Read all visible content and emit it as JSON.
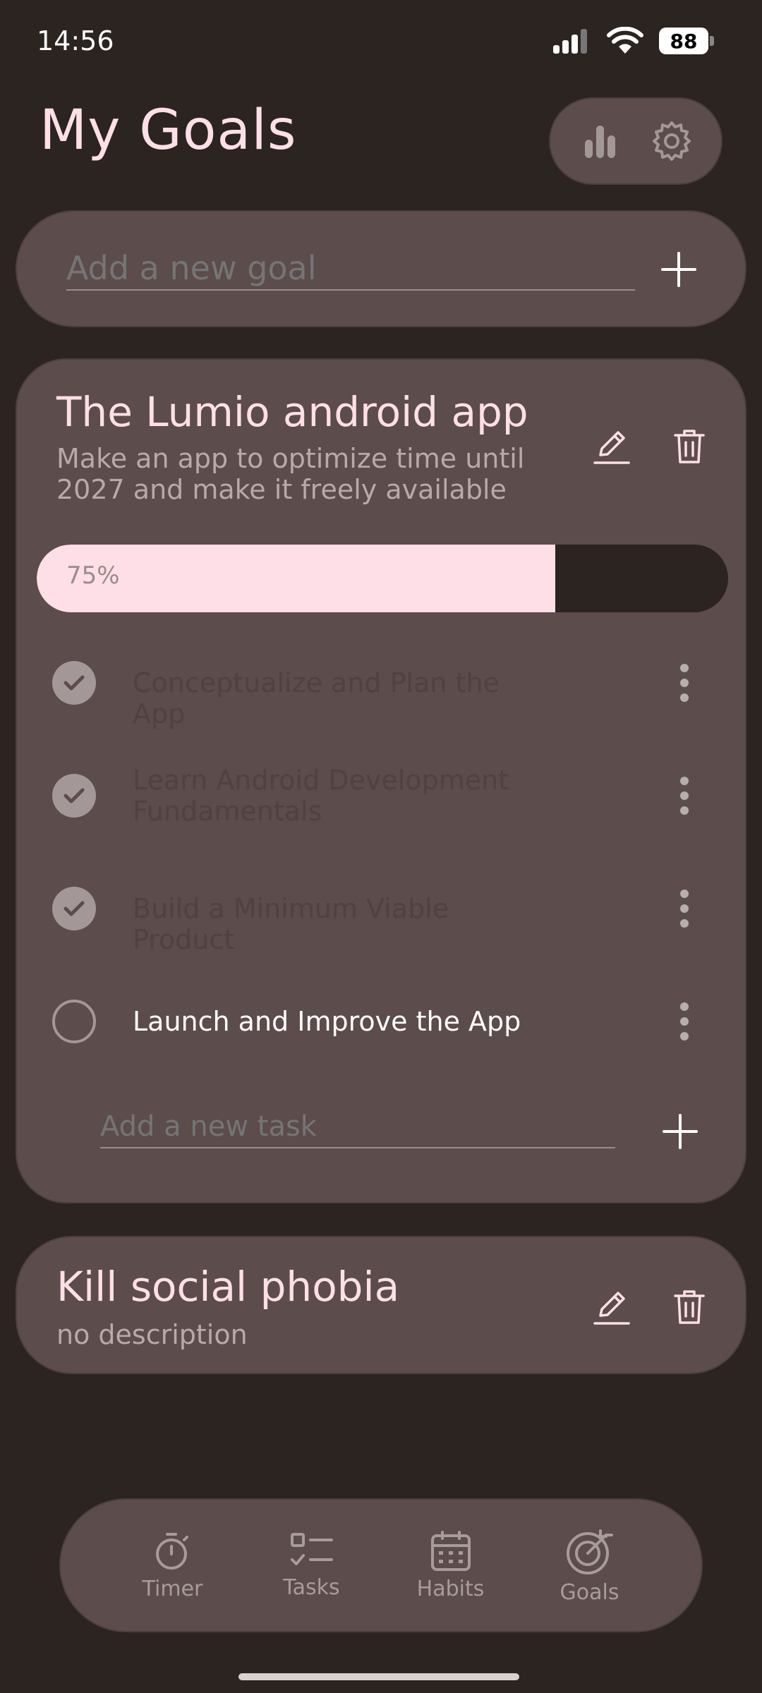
{
  "status_bar": {
    "time": "14:56",
    "battery": "88"
  },
  "header": {
    "title": "My Goals"
  },
  "new_goal": {
    "placeholder": "Add a new goal"
  },
  "goals": [
    {
      "title": "The Lumio android app",
      "description": "Make an app to optimize time until 2027 and make it freely available",
      "progress": 75,
      "progress_text": "75%",
      "tasks": [
        {
          "label": "Conceptualize and Plan the App",
          "done": true
        },
        {
          "label": "Learn Android Development Fundamentals",
          "done": true
        },
        {
          "label": "Build a Minimum Viable Product",
          "done": true
        },
        {
          "label": "Launch and Improve the App",
          "done": false
        }
      ],
      "new_task_placeholder": "Add a new task"
    },
    {
      "title": "Kill social phobia",
      "description": "no description"
    }
  ],
  "nav": [
    {
      "label": "Timer",
      "icon": "stopwatch-icon"
    },
    {
      "label": "Tasks",
      "icon": "checklist-icon"
    },
    {
      "label": "Habits",
      "icon": "calendar-icon"
    },
    {
      "label": "Goals",
      "icon": "target-icon"
    }
  ],
  "colors": {
    "background": "#2b2420",
    "card": "#5c4c4b",
    "accent": "#ffdfe7"
  }
}
